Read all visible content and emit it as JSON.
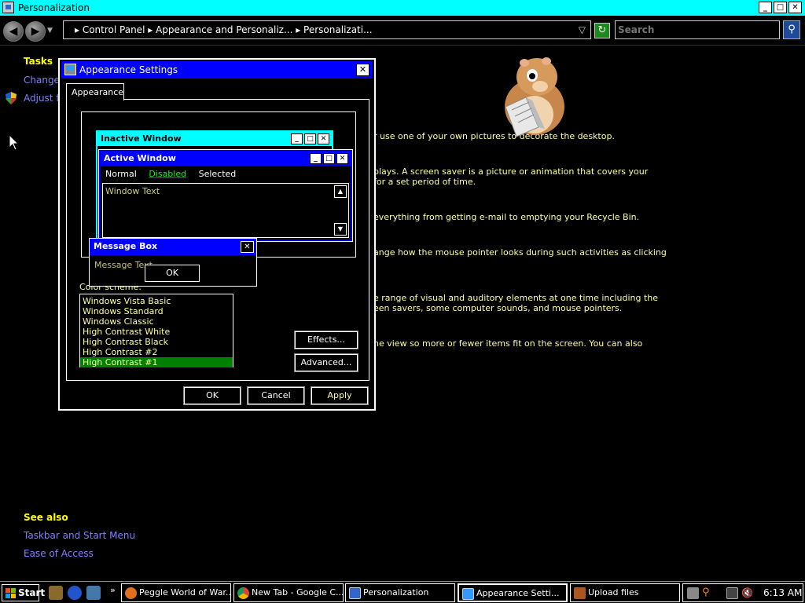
{
  "window": {
    "title": "Personalization",
    "caption_buttons": [
      "_",
      "□",
      "✕"
    ]
  },
  "address_bar": {
    "breadcrumb": "▸ Control Panel ▸ Appearance and Personaliz... ▸ Personalizati...",
    "search_placeholder": "Search"
  },
  "left_panel": {
    "tasks_title": "Tasks",
    "task_links": [
      "Change d",
      "Adjust for"
    ],
    "see_also_title": "See also",
    "see_also_links": [
      "Taskbar and Start Menu",
      "Ease of Access"
    ]
  },
  "background_text": [
    "r use one of your own pictures to decorate the desktop.",
    "plays. A screen saver is a picture or animation that covers your",
    "for a set period of time.",
    "everything from getting e-mail to emptying your Recycle Bin.",
    "ange how the mouse pointer looks during such activities as clicking",
    "e range of visual and auditory elements at one time including the",
    "een savers, some computer sounds, and mouse pointers.",
    "he view so more or fewer items fit on the screen. You can also"
  ],
  "dialog": {
    "title": "Appearance Settings",
    "close_label": "✕",
    "tab_label": "Appearance",
    "preview": {
      "inactive_title": "Inactive Window",
      "active_title": "Active Window",
      "menu_items": {
        "normal": "Normal",
        "disabled": "Disabled",
        "selected": "Selected"
      },
      "window_text": "Window Text",
      "message_box_title": "Message Box",
      "message_text": "Message Text",
      "ok_label": "OK"
    },
    "color_scheme_label": "Color scheme:",
    "color_schemes": [
      "Windows Vista Basic",
      "Windows Standard",
      "Windows Classic",
      "High Contrast White",
      "High Contrast Black",
      "High Contrast #2",
      "High Contrast #1"
    ],
    "selected_scheme": "High Contrast #1",
    "effects_label": "Effects...",
    "advanced_label": "Advanced...",
    "ok_label": "OK",
    "cancel_label": "Cancel",
    "apply_label": "Apply"
  },
  "taskbar": {
    "start_label": "Start",
    "more_label": "»",
    "tasks": [
      "Peggle World of War...",
      "New Tab - Google C...",
      "Personalization",
      "Appearance Setti...",
      "Upload files"
    ],
    "clock": "6:13 AM"
  },
  "colors": {
    "title_cyan": "#00ffff",
    "dialog_title_blue": "#0000ff",
    "heading_yellow": "#ffff00",
    "link_blue": "#8080ff",
    "selected_green": "#008000",
    "search_green": "#00ff00"
  }
}
